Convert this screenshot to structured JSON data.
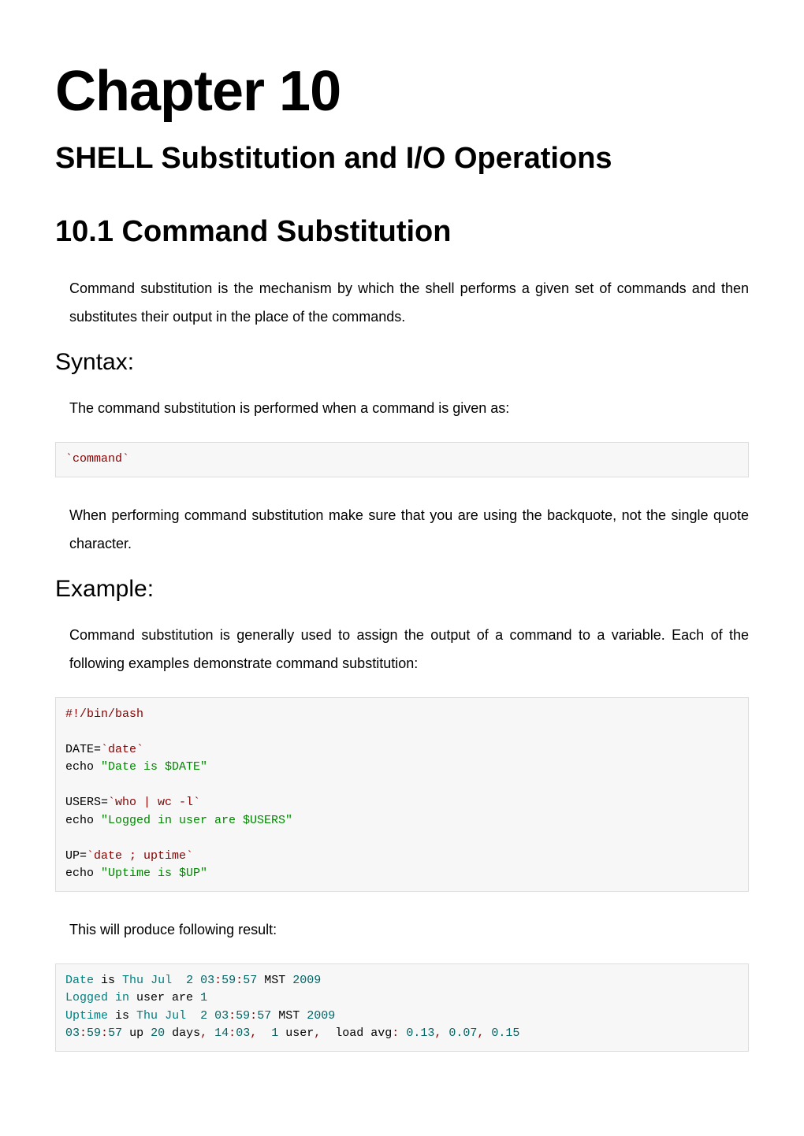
{
  "chapter": {
    "title": "Chapter 10",
    "subtitle": "SHELL Substitution and I/O Operations"
  },
  "section": {
    "title": "10.1 Command Substitution",
    "intro": "Command substitution is the mechanism by which the shell performs a given set of commands and then substitutes their output in the place of the commands."
  },
  "syntax": {
    "title": "Syntax:",
    "intro": "The command substitution is performed when a command is given as:",
    "code": "`command`",
    "note": "When performing command substitution make sure that you are using the backquote, not the single quote character."
  },
  "example": {
    "title": "Example:",
    "intro": "Command substitution is generally used to assign the output of a command to a variable. Each of the following examples demonstrate command substitution:",
    "result_intro": "This will produce following result:"
  },
  "code1": {
    "shebang": "#!/bin/bash",
    "date_assign_pre": "DATE",
    "date_backtick": "`date`",
    "echo1_pre": "echo ",
    "echo1_str": "\"Date is $DATE\"",
    "users_assign_pre": "USERS",
    "users_backtick": "`who | wc -l`",
    "echo2_pre": "echo ",
    "echo2_str": "\"Logged in user are $USERS\"",
    "up_assign_pre": "UP",
    "up_backtick": "`date ; uptime`",
    "echo3_pre": "echo ",
    "echo3_str": "\"Uptime is $UP\""
  },
  "code2": {
    "l1_a": "Date",
    "l1_b": " is ",
    "l1_c": "Thu",
    "l1_d": " ",
    "l1_e": "Jul",
    "l1_f": "  ",
    "l1_g": "2",
    "l1_h": " ",
    "l1_i": "03",
    "l1_j": ":",
    "l1_k": "59",
    "l1_l": ":",
    "l1_m": "57",
    "l1_n": " MST ",
    "l1_o": "2009",
    "l2_a": "Logged",
    "l2_b": " ",
    "l2_c": "in",
    "l2_d": " user are ",
    "l2_e": "1",
    "l3_a": "Uptime",
    "l3_b": " is ",
    "l3_c": "Thu",
    "l3_d": " ",
    "l3_e": "Jul",
    "l3_f": "  ",
    "l3_g": "2",
    "l3_h": " ",
    "l3_i": "03",
    "l3_j": ":",
    "l3_k": "59",
    "l3_l": ":",
    "l3_m": "57",
    "l3_n": " MST ",
    "l3_o": "2009",
    "l4_a": "03",
    "l4_b": ":",
    "l4_c": "59",
    "l4_d": ":",
    "l4_e": "57",
    "l4_f": " up ",
    "l4_g": "20",
    "l4_h": " days",
    "l4_i": ",",
    "l4_j": " ",
    "l4_k": "14",
    "l4_l": ":",
    "l4_m": "03",
    "l4_n": ",",
    "l4_o": "  ",
    "l4_p": "1",
    "l4_q": " user",
    "l4_r": ",",
    "l4_s": "  load avg",
    "l4_t": ":",
    "l4_u": " ",
    "l4_v": "0.13",
    "l4_w": ",",
    "l4_x": " ",
    "l4_y": "0.07",
    "l4_z": ",",
    "l4_aa": " ",
    "l4_ab": "0.15"
  }
}
